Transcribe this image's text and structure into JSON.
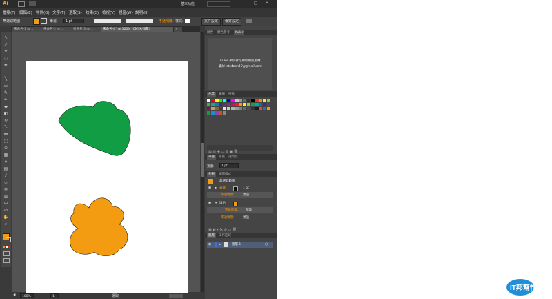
{
  "app": {
    "logo": "Ai",
    "workspace": "基本功能"
  },
  "menu": [
    "檔案(F)",
    "編輯(E)",
    "物件(O)",
    "文字(T)",
    "選取(S)",
    "效果(C)",
    "檢視(V)",
    "視窗(W)",
    "說明(H)"
  ],
  "control_bar": {
    "selection_label": "無選取範圍",
    "stroke_label": "筆畫:",
    "stroke_value": "1 pt",
    "opacity_label": "不透明度:",
    "style_label": "樣式:",
    "doc_setup_button": "文件設定",
    "prefs_button": "偏好設定"
  },
  "doc_tabs": [
    {
      "label": "未命名-1 @ ...",
      "active": false
    },
    {
      "label": "未命名-2 @ ...",
      "active": false
    },
    {
      "label": "未命名-3 @ ...",
      "active": false
    },
    {
      "label": "未命名-4* @ 100% (CMYK/預覽)",
      "active": true
    },
    {
      "label": "×",
      "active": false
    }
  ],
  "status": {
    "zoom": "100%",
    "page": "1",
    "mode": "選取"
  },
  "panels": {
    "top_tabs": [
      "顏色",
      "顏色參考",
      "Kuler"
    ],
    "kuler_line1": "Kuler 中沒有可用的顏色主題",
    "kuler_line2": "權杖: sts4pan12@gmail.com",
    "swatch_tabs": [
      "色票",
      "筆刷",
      "符號"
    ],
    "stroke_tabs": [
      "筆畫",
      "漸層",
      "透明度"
    ],
    "stroke_weight_label": "寬度:",
    "stroke_weight_value": "1 pt",
    "appearance_tabs": [
      "外觀",
      "繪圖樣式"
    ],
    "appearance": {
      "title": "無選取範圍",
      "stroke_label": "筆畫:",
      "stroke_value": "1 pt",
      "opacity1_label": "不透明度:",
      "opacity1_value": "預設",
      "fill_label": "填色:",
      "opacity2_label": "不透明度:",
      "opacity2_value": "預設",
      "opacity3_label": "不透明度:",
      "opacity3_value": "預設"
    },
    "layers_tabs": [
      "圖層",
      "工作區域"
    ],
    "layer_name": "圖層 1"
  },
  "canvas": {
    "shape1_fill": "#119d44",
    "shape2_fill": "#f39c12"
  },
  "watermark": "IT邦幫忙",
  "colors": {
    "accent": "#ff9a00",
    "ui_bg": "#3a3a3a"
  }
}
